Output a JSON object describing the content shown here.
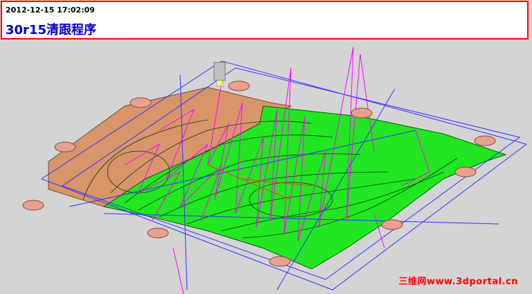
{
  "header": {
    "timestamp": "2012-12-15 17:02:09",
    "title": "30r15清跟程序"
  },
  "watermark": "三维网www.3dportal.cn",
  "colors": {
    "border": "#ff0000",
    "title": "#0000cc",
    "stock": "#d8956a",
    "machined_surface": "#22e622",
    "toolpath": "#ff00ff",
    "boundary": "#3333ff",
    "clamp_pad": "#e8a090",
    "tool": "#c0c0c0"
  }
}
